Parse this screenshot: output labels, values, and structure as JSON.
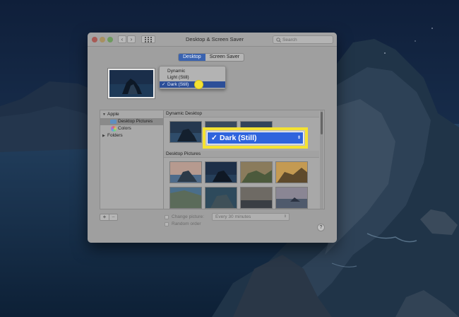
{
  "window": {
    "title": "Desktop & Screen Saver",
    "search_placeholder": "Search",
    "nav_back": "‹",
    "nav_forward": "›"
  },
  "tabs": [
    {
      "label": "Desktop",
      "active": true
    },
    {
      "label": "Screen Saver",
      "active": false
    }
  ],
  "appearance_menu": {
    "items": [
      "Dynamic",
      "Light (Still)",
      "Dark (Still)"
    ],
    "selected": "Dark (Still)",
    "checkmark": "✓"
  },
  "sidebar": {
    "groups": [
      {
        "label": "Apple",
        "expanded": true,
        "items": [
          {
            "label": "Desktop Pictures",
            "selected": true,
            "icon": "folder-icon"
          },
          {
            "label": "Colors",
            "selected": false,
            "icon": "color-wheel-icon"
          }
        ]
      },
      {
        "label": "Folders",
        "expanded": false,
        "items": []
      }
    ]
  },
  "content": {
    "sections": [
      "Dynamic Desktop",
      "Desktop Pictures"
    ]
  },
  "controls": {
    "add_label": "+",
    "remove_label": "−",
    "change_picture_label": "Change picture:",
    "interval_value": "Every 30 minutes",
    "random_order_label": "Random order",
    "help_label": "?"
  },
  "callout": {
    "label": "Dark (Still)",
    "checkmark": "✓",
    "color": "#f4e232"
  },
  "colors": {
    "accent": "#3a63b0",
    "highlight": "#2f64dd"
  }
}
